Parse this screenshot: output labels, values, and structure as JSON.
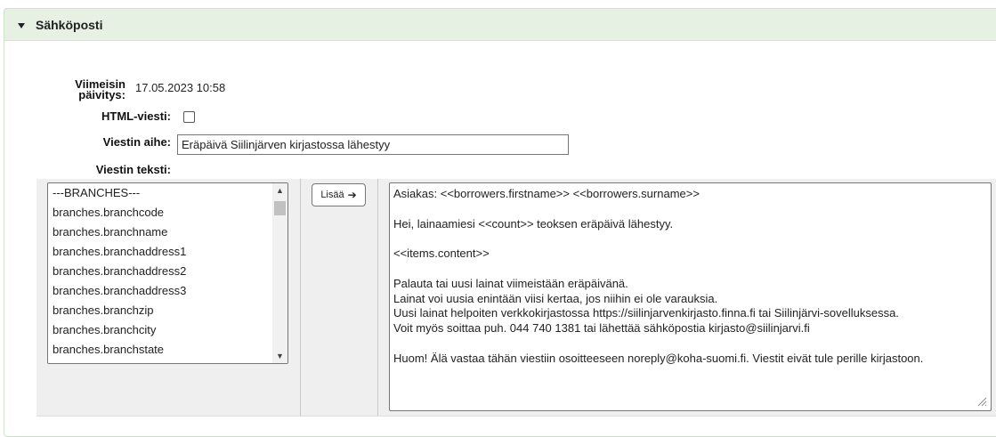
{
  "section": {
    "title": "Sähköposti"
  },
  "fields": {
    "last_updated_label": "Viimeisin päivitys:",
    "last_updated_value": "17.05.2023 10:58",
    "html_label": "HTML-viesti:",
    "html_checked": false,
    "subject_label": "Viestin aihe:",
    "subject_value": "Eräpäivä Siilinjärven kirjastossa lähestyy",
    "body_label": "Viestin teksti:"
  },
  "field_list": {
    "options": [
      "---BRANCHES---",
      "branches.branchcode",
      "branches.branchname",
      "branches.branchaddress1",
      "branches.branchaddress2",
      "branches.branchaddress3",
      "branches.branchzip",
      "branches.branchcity",
      "branches.branchstate"
    ]
  },
  "insert_button": {
    "label": "Lisää"
  },
  "message_body": "Asiakas: <<borrowers.firstname>> <<borrowers.surname>>\n\nHei, lainaamiesi <<count>> teoksen eräpäivä lähestyy.\n\n<<items.content>>\n\nPalauta tai uusi lainat viimeistään eräpäivänä.\nLainat voi uusia enintään viisi kertaa, jos niihin ei ole varauksia.\nUusi lainat helpoiten verkkokirjastossa https://siilinjarvenkirjasto.finna.fi tai Siilinjärvi-sovelluksessa.\nVoit myös soittaa puh. 044 740 1381 tai lähettää sähköpostia kirjasto@siilinjarvi.fi\n\nHuom! Älä vastaa tähän viestiin osoitteeseen noreply@koha-suomi.fi. Viestit eivät tule perille kirjastoon."
}
